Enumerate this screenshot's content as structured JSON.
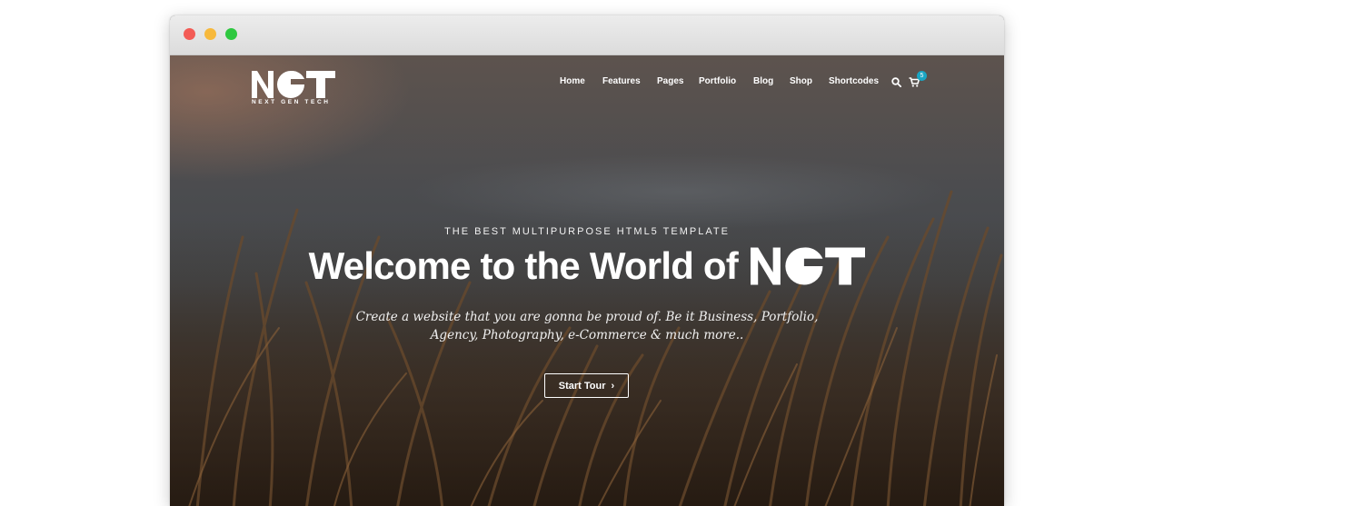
{
  "window": {
    "controls": [
      {
        "name": "close",
        "color": "#f35b55"
      },
      {
        "name": "minimize",
        "color": "#f7b93c"
      },
      {
        "name": "maximize",
        "color": "#2ec840"
      }
    ]
  },
  "brand": {
    "logo_text": "NGT",
    "tagline": "NEXT GEN TECH"
  },
  "nav": {
    "items": [
      "Home",
      "Features",
      "Pages",
      "Portfolio",
      "Blog",
      "Shop",
      "Shortcodes"
    ],
    "search_icon": "search-icon",
    "cart_icon": "cart-icon",
    "cart_count": "5"
  },
  "hero": {
    "eyebrow": "THE BEST MULTIPURPOSE HTML5 TEMPLATE",
    "headline": "Welcome to the World of",
    "headline_logo": "NGT",
    "description_line1": "Create a website that you are gonna be proud of. Be it Business, Portfolio,",
    "description_line2": "Agency, Photography, e-Commerce & much more..",
    "cta_label": "Start Tour",
    "cta_icon": "chevron-right-icon"
  },
  "colors": {
    "accent": "#1aa6c4",
    "text": "#ffffff"
  }
}
